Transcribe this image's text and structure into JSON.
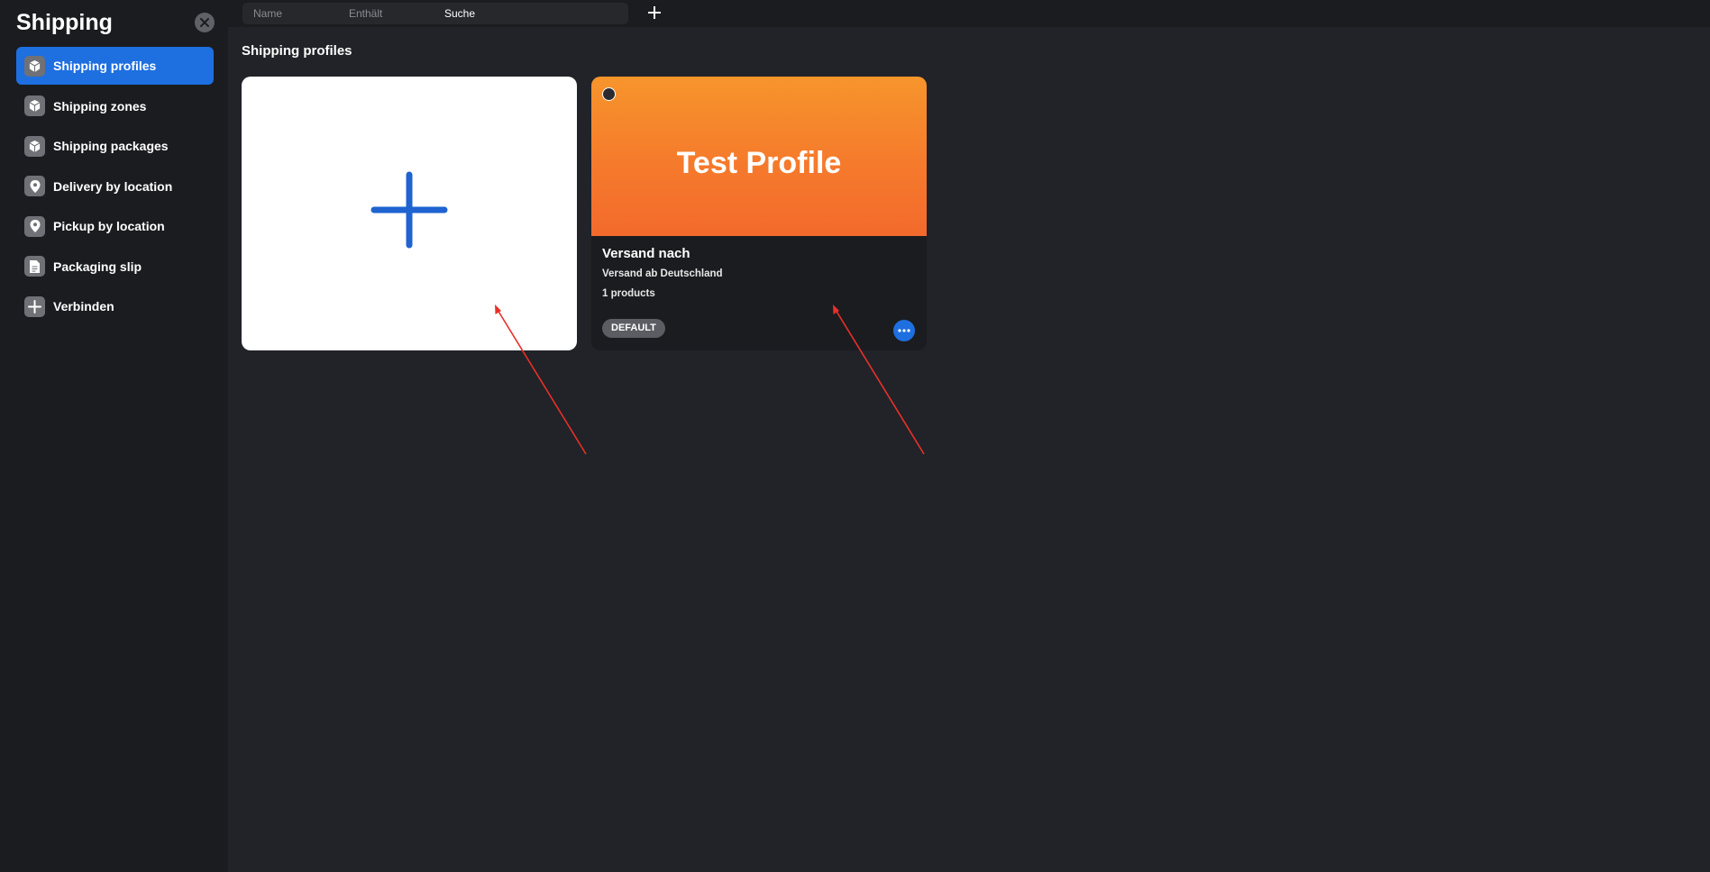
{
  "sidebar": {
    "title": "Shipping",
    "items": [
      {
        "label": "Shipping profiles",
        "icon": "box-icon",
        "active": true
      },
      {
        "label": "Shipping zones",
        "icon": "box-icon",
        "active": false
      },
      {
        "label": "Shipping packages",
        "icon": "box-icon",
        "active": false
      },
      {
        "label": "Delivery by location",
        "icon": "location-pin-icon",
        "active": false
      },
      {
        "label": "Pickup by location",
        "icon": "location-pin-icon",
        "active": false
      },
      {
        "label": "Packaging slip",
        "icon": "document-icon",
        "active": false
      },
      {
        "label": "Verbinden",
        "icon": "plus-icon",
        "active": false
      }
    ]
  },
  "filter": {
    "field": "Name",
    "operator": "Enthält",
    "value": "Suche"
  },
  "main": {
    "section_title": "Shipping profiles",
    "profile_card": {
      "banner_title": "Test Profile",
      "title": "Versand nach",
      "subtitle": "Versand ab Deutschland",
      "count": "1 products",
      "badge": "DEFAULT"
    }
  },
  "colors": {
    "accent": "#1e6fe0",
    "banner_orange": "#f7952c",
    "annotation_arrow": "#e8302a"
  }
}
